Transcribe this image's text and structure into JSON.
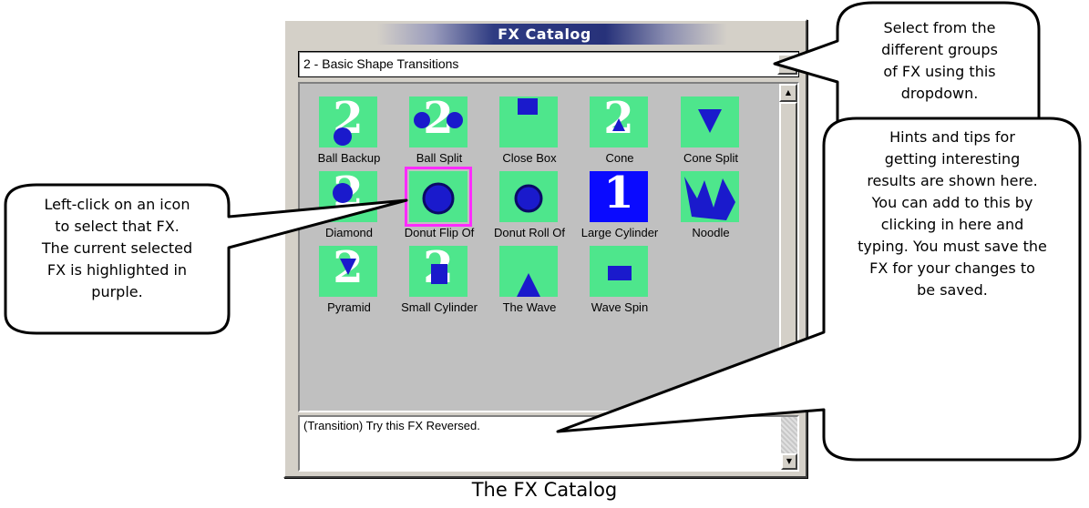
{
  "window": {
    "title": "FX Catalog",
    "group_dropdown": {
      "selected": "2 - Basic Shape Transitions"
    },
    "fx_items": [
      {
        "label": "Ball Backup",
        "digit": "2",
        "selected": false
      },
      {
        "label": "Ball Split",
        "digit": "2",
        "selected": false
      },
      {
        "label": "Close Box",
        "digit": "",
        "selected": false
      },
      {
        "label": "Cone",
        "digit": "2",
        "selected": false
      },
      {
        "label": "Cone Split",
        "digit": "",
        "selected": false
      },
      {
        "label": "Diamond",
        "digit": "2",
        "selected": false
      },
      {
        "label": "Donut Flip Of",
        "digit": "",
        "selected": true
      },
      {
        "label": "Donut Roll Of",
        "digit": "",
        "selected": false
      },
      {
        "label": "Large Cylinder",
        "digit": "1",
        "selected": false
      },
      {
        "label": "Noodle",
        "digit": "",
        "selected": false
      },
      {
        "label": "Pyramid",
        "digit": "2",
        "selected": false
      },
      {
        "label": "Small Cylinder",
        "digit": "2",
        "selected": false
      },
      {
        "label": "The Wave",
        "digit": "",
        "selected": false
      },
      {
        "label": "Wave Spin",
        "digit": "",
        "selected": false
      }
    ],
    "hint_text": "(Transition) Try this FX Reversed.",
    "colors": {
      "thumb_bg": "#4ee68c",
      "selection": "#ff2bff",
      "shape": "#1a1acc"
    }
  },
  "callouts": {
    "dropdown_tip": [
      "Select from the",
      "different groups",
      "of FX using this",
      "dropdown."
    ],
    "select_tip": [
      "Left-click on an icon",
      "to select that FX.",
      "The current selected",
      "FX is highlighted in",
      "purple."
    ],
    "hints_tip": [
      "Hints and tips for",
      "getting interesting",
      "results are shown here.",
      "You can add to this by",
      "clicking in here and",
      "typing. You must save the",
      "FX for your changes to",
      "be saved."
    ]
  },
  "caption": "The FX Catalog"
}
